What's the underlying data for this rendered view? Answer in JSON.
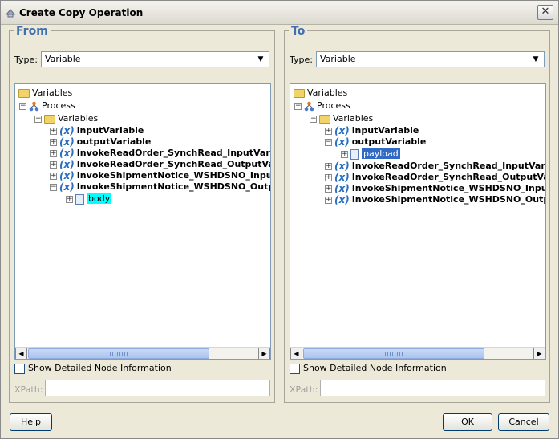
{
  "window": {
    "title": "Create Copy Operation",
    "close_glyph": "✕"
  },
  "from_panel": {
    "legend": "From",
    "type_label": "Type:",
    "type_value": "Variable",
    "tree": {
      "root": "Variables",
      "process": "Process",
      "variables": "Variables",
      "items": [
        "inputVariable",
        "outputVariable",
        "InvokeReadOrder_SynchRead_InputVaria",
        "InvokeReadOrder_SynchRead_OutputVar",
        "InvokeShipmentNotice_WSHDSNO_InputV",
        "InvokeShipmentNotice_WSHDSNO_Outpu"
      ],
      "child": "body"
    },
    "checkbox_label": "Show Detailed Node Information",
    "xpath_label": "XPath:",
    "xpath_value": ""
  },
  "to_panel": {
    "legend": "To",
    "type_label": "Type:",
    "type_value": "Variable",
    "tree": {
      "root": "Variables",
      "process": "Process",
      "variables": "Variables",
      "items": [
        "inputVariable",
        "outputVariable",
        "InvokeReadOrder_SynchRead_InputVaria",
        "InvokeReadOrder_SynchRead_OutputVar",
        "InvokeShipmentNotice_WSHDSNO_InputV",
        "InvokeShipmentNotice_WSHDSNO_Outpu"
      ],
      "child": "payload"
    },
    "checkbox_label": "Show Detailed Node Information",
    "xpath_label": "XPath:",
    "xpath_value": ""
  },
  "buttons": {
    "help": "Help",
    "ok": "OK",
    "cancel": "Cancel"
  },
  "colors": {
    "legend": "#3f6fb0",
    "highlight_from": "#00ffff",
    "highlight_to": "#316ac5"
  },
  "icons": {
    "folder": "folder-icon",
    "process": "process-icon",
    "variable": "variable-icon",
    "element": "element-icon"
  },
  "glyphs": {
    "expand": "+",
    "collapse": "−",
    "variable": "(x)",
    "dropdown": "▼",
    "scroll_left": "◀",
    "scroll_right": "▶"
  }
}
